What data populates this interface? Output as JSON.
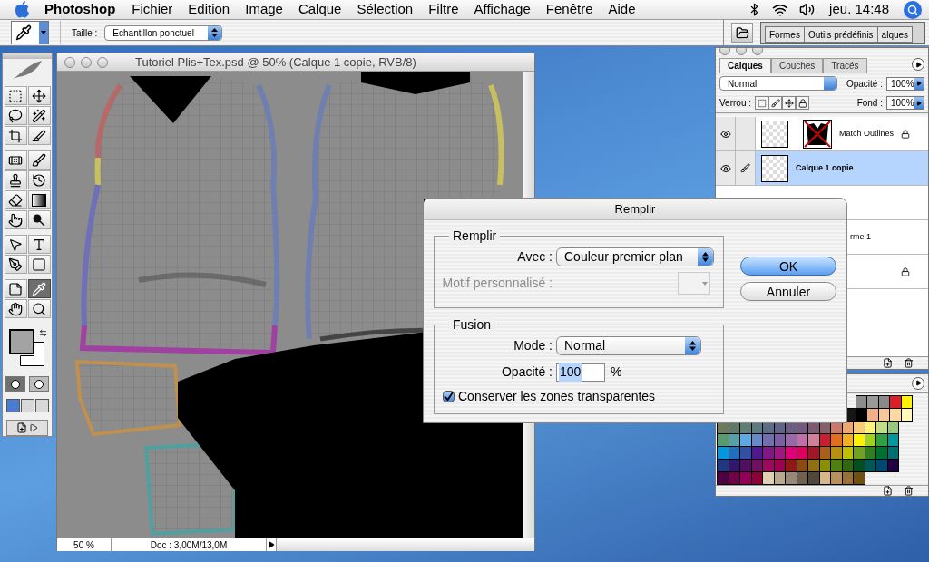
{
  "menubar": {
    "app": "Photoshop",
    "menus": [
      "Fichier",
      "Edition",
      "Image",
      "Calque",
      "Sélection",
      "Filtre",
      "Affichage",
      "Fenêtre",
      "Aide"
    ],
    "clock": "jeu. 14:48"
  },
  "options_bar": {
    "size_label": "Taille :",
    "size_value": "Echantillon ponctuel",
    "well_tabs": [
      "Formes",
      "Outils prédéfinis",
      "alques"
    ]
  },
  "toolbox": {
    "tools": [
      {
        "kind": "marquee",
        "selected": false
      },
      {
        "kind": "move",
        "selected": false
      },
      {
        "kind": "lasso",
        "selected": false
      },
      {
        "kind": "wand",
        "selected": false
      },
      {
        "kind": "crop",
        "selected": false
      },
      {
        "kind": "slice",
        "selected": false
      },
      {
        "kind": "healing",
        "selected": false
      },
      {
        "kind": "brush",
        "selected": false
      },
      {
        "kind": "stamp",
        "selected": false
      },
      {
        "kind": "history",
        "selected": false
      },
      {
        "kind": "eraser",
        "selected": false
      },
      {
        "kind": "gradient",
        "selected": false
      },
      {
        "kind": "smudge",
        "selected": false
      },
      {
        "kind": "dodge",
        "selected": false
      },
      {
        "kind": "select",
        "selected": false
      },
      {
        "kind": "type",
        "selected": false
      },
      {
        "kind": "pen",
        "selected": false
      },
      {
        "kind": "shape",
        "selected": false
      },
      {
        "kind": "notes",
        "selected": false
      },
      {
        "kind": "eyedropper",
        "selected": true
      },
      {
        "kind": "hand",
        "selected": false
      },
      {
        "kind": "zoom",
        "selected": false
      }
    ],
    "colors": [
      {
        "kind": "foreground",
        "color": "#a3a3a3"
      },
      {
        "kind": "background",
        "color": "#ffffff"
      }
    ],
    "mask_modes": [
      {
        "selected": true
      },
      {
        "selected": false
      }
    ],
    "screen_modes": [
      {
        "selected": true
      },
      {
        "selected": false
      },
      {
        "selected": false
      }
    ]
  },
  "document": {
    "title": "Tutoriel Plis+Tex.psd @ 50% (Calque 1 copie, RVB/8)",
    "zoom": "50 %",
    "doc_info": "Doc : 3,00M/13,0M"
  },
  "layers_panel": {
    "tabs": [
      {
        "label": "Calques",
        "selected": true
      },
      {
        "label": "Couches",
        "selected": false
      },
      {
        "label": "Tracés",
        "selected": false
      }
    ],
    "blend_mode": "Normal",
    "opacity_label": "Opacité :",
    "opacity": "100%",
    "lock_label": "Verrou :",
    "fill_label": "Fond :",
    "fill": "100%",
    "layers": [
      {
        "kind": "masked",
        "name": "Match Outlines",
        "visible": true,
        "selected": false,
        "locked": true
      },
      {
        "kind": "plain",
        "name": "Calque 1 copie",
        "visible": true,
        "selected": true,
        "locked": false
      },
      {
        "kind": "covered"
      },
      {
        "kind": "covered",
        "name": "rme 1"
      },
      {
        "kind": "covered",
        "locked": true
      }
    ]
  },
  "swatches": {
    "rows": [
      [
        {
          "color": "#8c8c8c"
        },
        {
          "color": "#999999"
        },
        {
          "color": "#8a8a8a"
        },
        {
          "color": "#d9202a"
        },
        {
          "color": "#fff200"
        }
      ],
      [
        {
          "color": "#161616"
        },
        {
          "color": "#000000"
        },
        {
          "color": "#f0b088"
        },
        {
          "color": "#f8c898"
        },
        {
          "color": "#fcd9a0"
        },
        {
          "color": "#fff8b8"
        }
      ],
      [
        {
          "color": "#6e7a5e"
        },
        {
          "color": "#607a66"
        },
        {
          "color": "#5f7f74"
        },
        {
          "color": "#5b7b82"
        },
        {
          "color": "#5b6d84"
        },
        {
          "color": "#5e6484"
        },
        {
          "color": "#6a5f82"
        },
        {
          "color": "#715a7c"
        },
        {
          "color": "#7b5a72"
        },
        {
          "color": "#83606c"
        },
        {
          "color": "#c87a6a"
        },
        {
          "color": "#eca870"
        },
        {
          "color": "#f8cc78"
        },
        {
          "color": "#fff37a"
        },
        {
          "color": "#c4dc88"
        },
        {
          "color": "#98c880"
        }
      ],
      [
        {
          "color": "#5a9a70"
        },
        {
          "color": "#58a0a8"
        },
        {
          "color": "#60a8e0"
        },
        {
          "color": "#6888c8"
        },
        {
          "color": "#7070b0"
        },
        {
          "color": "#7a60a0"
        },
        {
          "color": "#9868a8"
        },
        {
          "color": "#c070a8"
        },
        {
          "color": "#d08098"
        },
        {
          "color": "#c81e30"
        },
        {
          "color": "#e07020"
        },
        {
          "color": "#f0b020"
        },
        {
          "color": "#fff200"
        },
        {
          "color": "#a0d020"
        },
        {
          "color": "#30a040"
        },
        {
          "color": "#0098a0"
        }
      ],
      [
        {
          "color": "#0098e0"
        },
        {
          "color": "#2070c0"
        },
        {
          "color": "#3050a0"
        },
        {
          "color": "#501890"
        },
        {
          "color": "#801888"
        },
        {
          "color": "#a01880"
        },
        {
          "color": "#e0007a"
        },
        {
          "color": "#e00060"
        },
        {
          "color": "#a01828"
        },
        {
          "color": "#a86018"
        },
        {
          "color": "#b89010"
        },
        {
          "color": "#c0c000"
        },
        {
          "color": "#70a020"
        },
        {
          "color": "#308020"
        },
        {
          "color": "#007030"
        },
        {
          "color": "#007070"
        }
      ],
      [
        {
          "color": "#203880"
        },
        {
          "color": "#301870"
        },
        {
          "color": "#501060"
        },
        {
          "color": "#701060"
        },
        {
          "color": "#a00860"
        },
        {
          "color": "#a00050"
        },
        {
          "color": "#901818"
        },
        {
          "color": "#8a4a10"
        },
        {
          "color": "#907010"
        },
        {
          "color": "#8a9000"
        },
        {
          "color": "#508010"
        },
        {
          "color": "#306810"
        },
        {
          "color": "#005020"
        },
        {
          "color": "#005858"
        },
        {
          "color": "#004870"
        },
        {
          "color": "#200040"
        }
      ],
      [
        {
          "color": "#500040"
        },
        {
          "color": "#700048"
        },
        {
          "color": "#900058"
        },
        {
          "color": "#900038"
        },
        {
          "color": "#e0d0b0"
        },
        {
          "color": "#b8a890"
        },
        {
          "color": "#988878"
        },
        {
          "color": "#706050"
        },
        {
          "color": "#504838"
        },
        {
          "color": "#d8b888"
        },
        {
          "color": "#b89060"
        },
        {
          "color": "#987038"
        },
        {
          "color": "#705010"
        }
      ]
    ]
  },
  "fill_dialog": {
    "title": "Remplir",
    "fill_group": {
      "legend": "Remplir",
      "use_label": "Avec :",
      "use_value": "Couleur premier plan",
      "pattern_label": "Motif personnalisé :",
      "pattern_disabled": true
    },
    "blend_group": {
      "legend": "Fusion",
      "mode_label": "Mode :",
      "mode_value": "Normal",
      "opacity_label": "Opacité :",
      "opacity_value": "100",
      "opacity_unit": "%",
      "preserve_label": "Conserver les zones transparentes",
      "preserve_checked": true
    },
    "buttons": [
      {
        "label": "OK",
        "default": true
      },
      {
        "label": "Annuler",
        "default": false
      }
    ]
  }
}
